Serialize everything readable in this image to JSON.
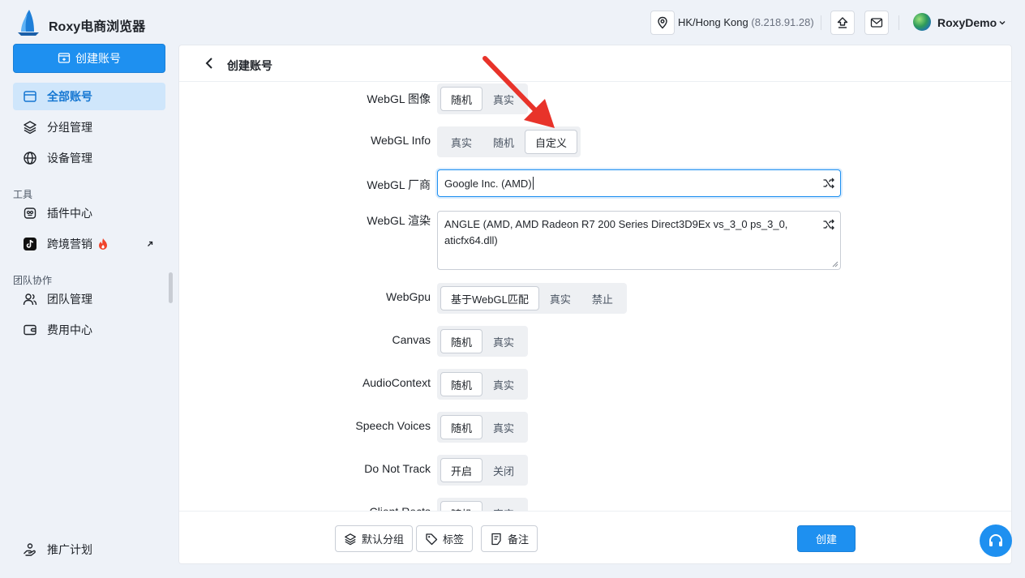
{
  "app": {
    "title": "Roxy电商浏览器"
  },
  "topbar": {
    "location": "HK/Hong Kong",
    "ip": "(8.218.91.28)",
    "user": "RoxyDemo"
  },
  "sidebar": {
    "create_label": "创建账号",
    "items": [
      {
        "label": "全部账号"
      },
      {
        "label": "分组管理"
      },
      {
        "label": "设备管理"
      }
    ],
    "tools_title": "工具",
    "tools": [
      {
        "label": "插件中心"
      },
      {
        "label": "跨境营销"
      }
    ],
    "team_title": "团队协作",
    "team": [
      {
        "label": "团队管理"
      },
      {
        "label": "费用中心"
      }
    ],
    "promo_label": "推广计划"
  },
  "page": {
    "title": "创建账号"
  },
  "form": {
    "webgl_image": {
      "label": "WebGL 图像",
      "options": [
        "随机",
        "真实"
      ],
      "selected": "随机"
    },
    "webgl_info": {
      "label": "WebGL Info",
      "options": [
        "真实",
        "随机",
        "自定义"
      ],
      "selected": "自定义"
    },
    "webgl_vendor": {
      "label": "WebGL 厂商",
      "value": "Google Inc. (AMD)"
    },
    "webgl_render": {
      "label": "WebGL 渲染",
      "value": "ANGLE (AMD, AMD Radeon R7 200 Series Direct3D9Ex vs_3_0 ps_3_0, aticfx64.dll)"
    },
    "webgpu": {
      "label": "WebGpu",
      "options": [
        "基于WebGL匹配",
        "真实",
        "禁止"
      ],
      "selected": "基于WebGL匹配"
    },
    "canvas": {
      "label": "Canvas",
      "options": [
        "随机",
        "真实"
      ],
      "selected": "随机"
    },
    "audio": {
      "label": "AudioContext",
      "options": [
        "随机",
        "真实"
      ],
      "selected": "随机"
    },
    "speech": {
      "label": "Speech Voices",
      "options": [
        "随机",
        "真实"
      ],
      "selected": "随机"
    },
    "dnt": {
      "label": "Do Not Track",
      "options": [
        "开启",
        "关闭"
      ],
      "selected": "开启"
    },
    "client_rects": {
      "label": "Client Rects",
      "options": [
        "随机",
        "真实"
      ],
      "selected": "随机"
    }
  },
  "footer": {
    "group_label": "默认分组",
    "tag_label": "标签",
    "note_label": "备注",
    "submit_label": "创建"
  },
  "colors": {
    "accent": "#1e90f0",
    "arrow": "#e8332a"
  }
}
